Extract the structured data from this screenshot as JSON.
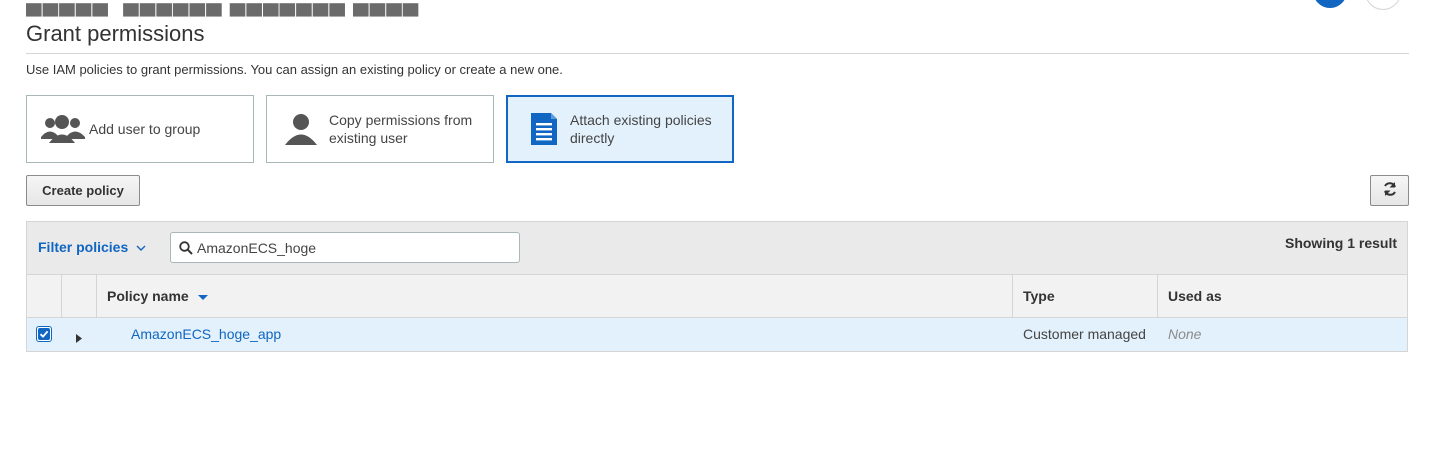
{
  "page": {
    "title": "Grant permissions",
    "description": "Use IAM policies to grant permissions. You can assign an existing policy or create a new one."
  },
  "options": [
    {
      "label": "Add user to group",
      "icon": "group-icon",
      "selected": false
    },
    {
      "label": "Copy permissions from existing user",
      "icon": "user-icon",
      "selected": false
    },
    {
      "label": "Attach existing policies directly",
      "icon": "document-icon",
      "selected": true
    }
  ],
  "toolbar": {
    "create_policy_label": "Create policy",
    "refresh_icon": "refresh-icon"
  },
  "filter": {
    "label": "Filter policies",
    "search_value": "AmazonECS_hoge",
    "showing": "Showing 1 result"
  },
  "table": {
    "columns": [
      "Policy name",
      "Type",
      "Used as"
    ],
    "rows": [
      {
        "name": "AmazonECS_hoge_app",
        "type": "Customer managed",
        "used_as": "None",
        "checked": true
      }
    ]
  },
  "colors": {
    "accent": "#1066c2",
    "selected_bg": "#e3f1fc",
    "header_bg": "#eaeaea"
  }
}
